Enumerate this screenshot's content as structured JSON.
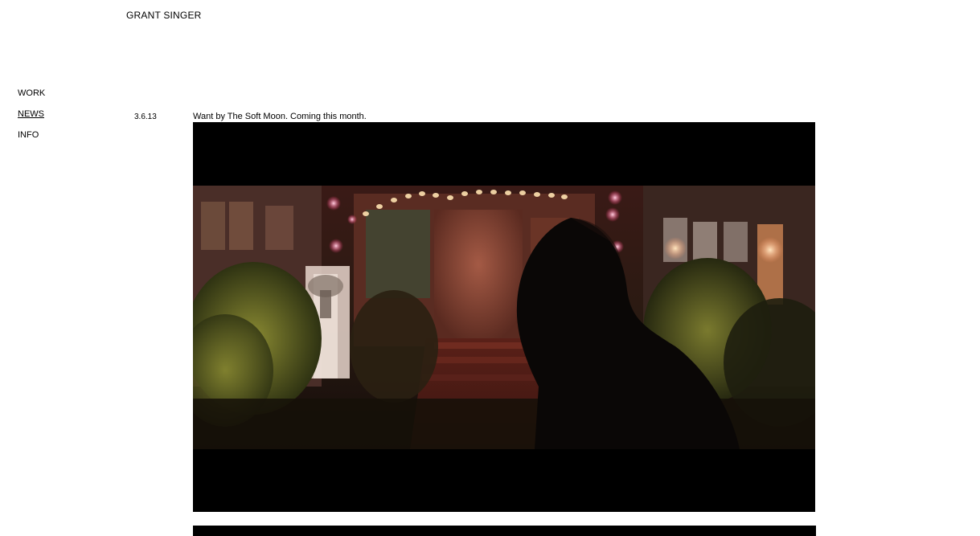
{
  "header": {
    "site_title": "GRANT SINGER"
  },
  "nav": {
    "items": [
      {
        "label": "WORK"
      },
      {
        "label": "NEWS"
      },
      {
        "label": "INFO"
      }
    ]
  },
  "post": {
    "date": "3.6.13",
    "caption": "Want by The Soft Moon. Coming this month."
  },
  "colors": {
    "background": "#ffffff",
    "text": "#000000",
    "video_letterbox": "#000000"
  }
}
